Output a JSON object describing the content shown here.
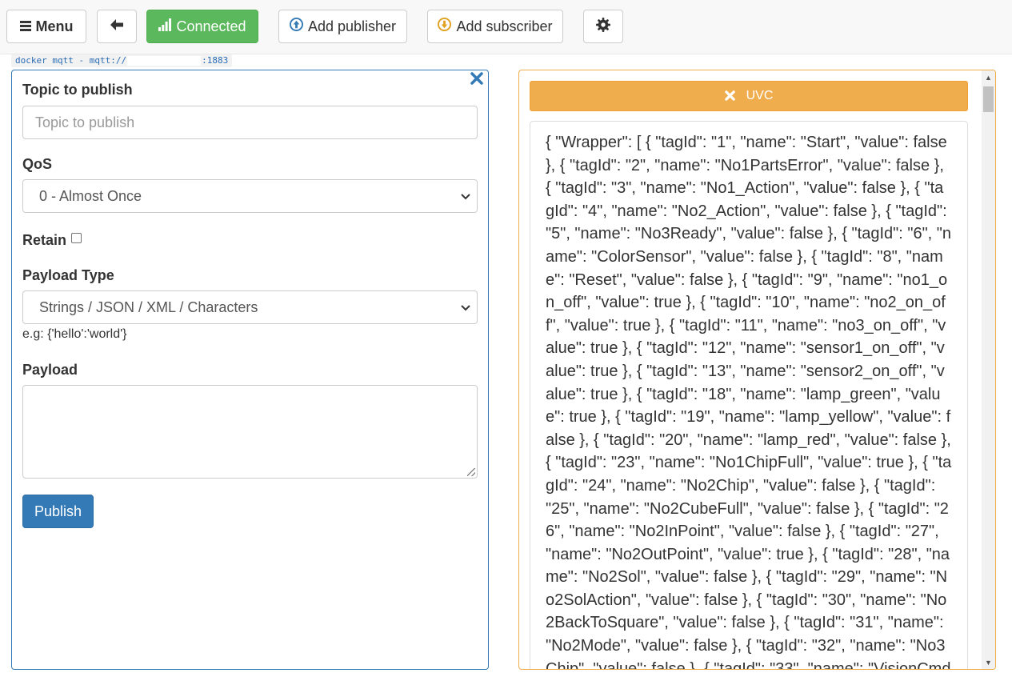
{
  "toolbar": {
    "menu_label": "Menu",
    "connected_label": "Connected",
    "add_publisher_label": "Add publisher",
    "add_subscriber_label": "Add subscriber"
  },
  "connection": {
    "prefix": "docker mqtt - mqtt://",
    "port": ":1883"
  },
  "publisher": {
    "topic_label": "Topic to publish",
    "topic_placeholder": "Topic to publish",
    "qos_label": "QoS",
    "qos_selected": "0 - Almost Once",
    "retain_label": "Retain",
    "payload_type_label": "Payload Type",
    "payload_type_selected": "Strings / JSON / XML / Characters",
    "payload_hint": "e.g: {'hello':'world'}",
    "payload_label": "Payload",
    "publish_label": "Publish"
  },
  "subscriber": {
    "topic": "UVC",
    "message": "{ \"Wrapper\": [ { \"tagId\": \"1\", \"name\": \"Start\", \"value\": false }, { \"tagId\": \"2\", \"name\": \"No1PartsError\", \"value\": false }, { \"tagId\": \"3\", \"name\": \"No1_Action\", \"value\": false }, { \"tagId\": \"4\", \"name\": \"No2_Action\", \"value\": false }, { \"tagId\": \"5\", \"name\": \"No3Ready\", \"value\": false }, { \"tagId\": \"6\", \"name\": \"ColorSensor\", \"value\": false }, { \"tagId\": \"8\", \"name\": \"Reset\", \"value\": false }, { \"tagId\": \"9\", \"name\": \"no1_on_off\", \"value\": true }, { \"tagId\": \"10\", \"name\": \"no2_on_off\", \"value\": true }, { \"tagId\": \"11\", \"name\": \"no3_on_off\", \"value\": true }, { \"tagId\": \"12\", \"name\": \"sensor1_on_off\", \"value\": true }, { \"tagId\": \"13\", \"name\": \"sensor2_on_off\", \"value\": true }, { \"tagId\": \"18\", \"name\": \"lamp_green\", \"value\": true }, { \"tagId\": \"19\", \"name\": \"lamp_yellow\", \"value\": false }, { \"tagId\": \"20\", \"name\": \"lamp_red\", \"value\": false }, { \"tagId\": \"23\", \"name\": \"No1ChipFull\", \"value\": true }, { \"tagId\": \"24\", \"name\": \"No2Chip\", \"value\": false }, { \"tagId\": \"25\", \"name\": \"No2CubeFull\", \"value\": false }, { \"tagId\": \"26\", \"name\": \"No2InPoint\", \"value\": false }, { \"tagId\": \"27\", \"name\": \"No2OutPoint\", \"value\": true }, { \"tagId\": \"28\", \"name\": \"No2Sol\", \"value\": false }, { \"tagId\": \"29\", \"name\": \"No2SolAction\", \"value\": false }, { \"tagId\": \"30\", \"name\": \"No2BackToSquare\", \"value\": false }, { \"tagId\": \"31\", \"name\": \"No2Mode\", \"value\": false }, { \"tagId\": \"32\", \"name\": \"No3Chip\", \"value\": false }, { \"tagId\": \"33\", \"name\": \"VisionCmd"
  },
  "colors": {
    "connected": "#5cb85c",
    "primary": "#337ab7",
    "warning": "#f0ad4e"
  },
  "icons": {
    "menu": "hamburger-icon",
    "back": "arrow-left-icon",
    "connected": "signal-icon",
    "add_publisher": "arrow-circle-up-icon",
    "add_subscriber": "arrow-circle-down-icon",
    "settings": "gear-icon",
    "close": "close-icon"
  }
}
